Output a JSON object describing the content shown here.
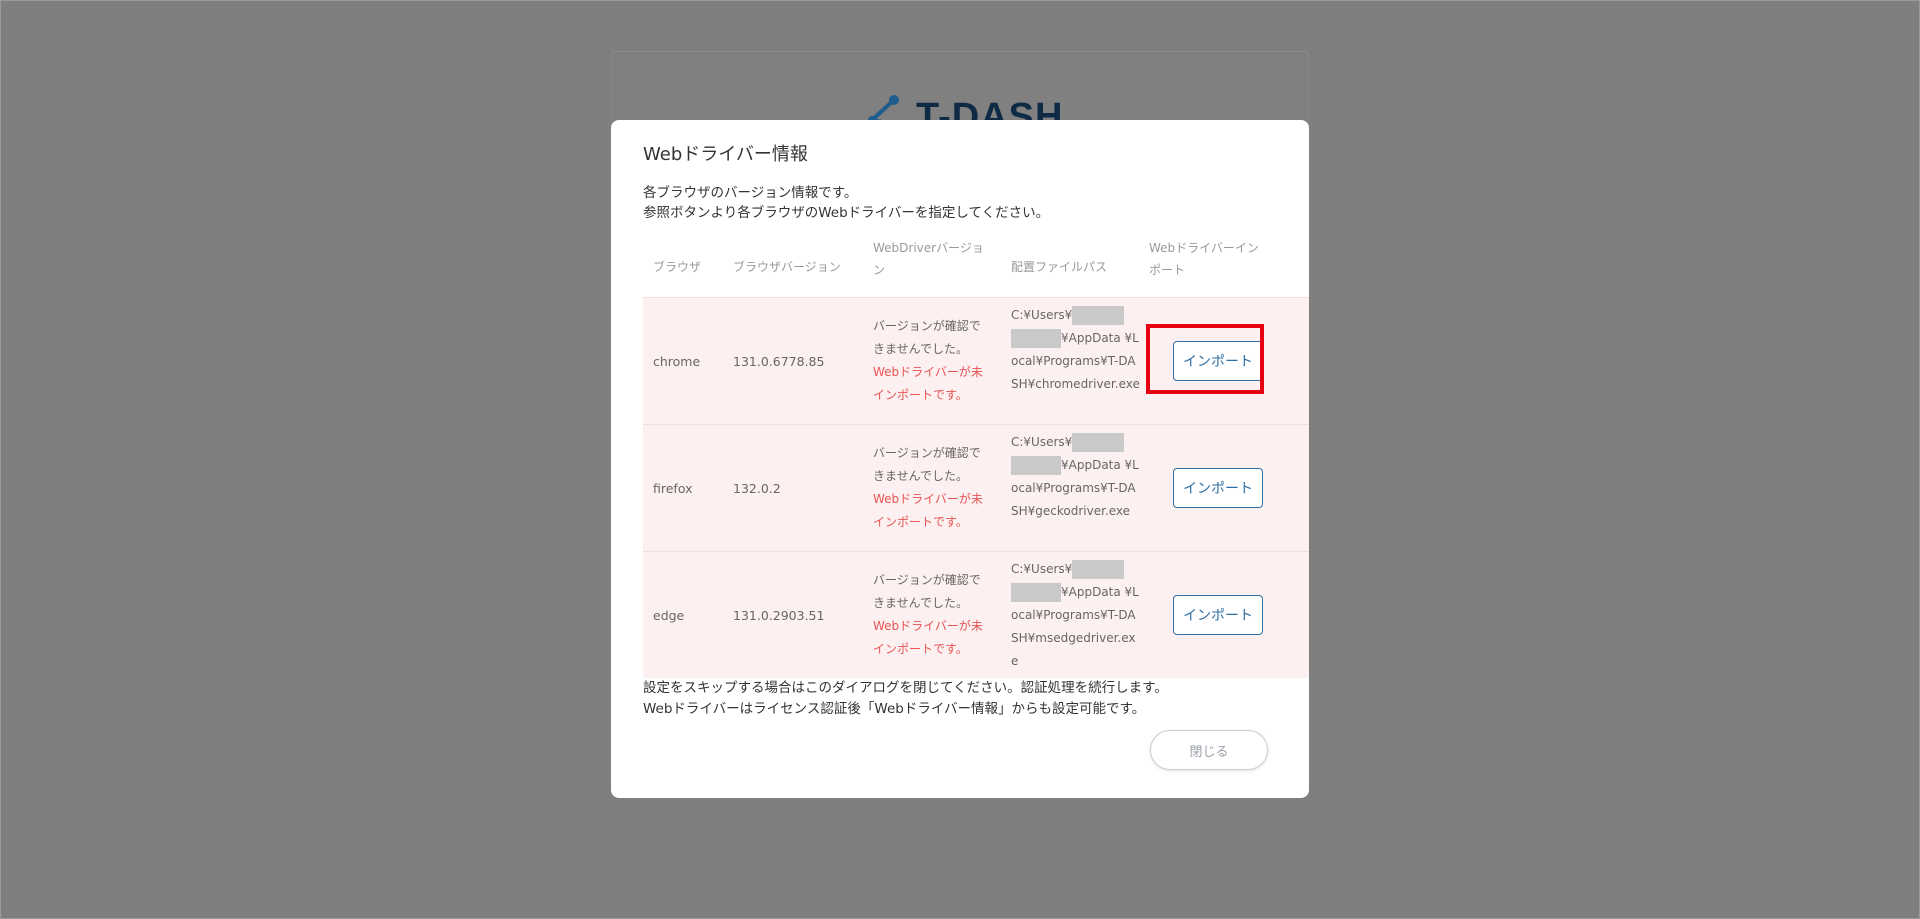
{
  "background": {
    "logo_text": "T-DASH"
  },
  "dialog": {
    "title": "Webドライバー情報",
    "description": [
      "各ブラウザのバージョン情報です。",
      "参照ボタンより各ブラウザのWebドライバーを指定してください。"
    ],
    "columns": {
      "browser": "ブラウザ",
      "browser_version": "ブラウザバージョン",
      "driver_version": [
        "WebDriverバージョ",
        "ン"
      ],
      "path": "配置ファイルパス",
      "import": [
        "Webドライバーイン",
        "ポート"
      ]
    },
    "rows": [
      {
        "browser": "chrome",
        "version": "131.0.6778.85",
        "status_lines": [
          "バージョンが確認で",
          "きませんでした。"
        ],
        "warning_lines": [
          "Webドライバーが未",
          "インポートです。"
        ],
        "path_start": "C:¥Users¥",
        "path_end": "¥AppData ¥Local¥Programs¥T-DASH¥chromedriver.exe",
        "import_label": "インポート"
      },
      {
        "browser": "firefox",
        "version": "132.0.2",
        "status_lines": [
          "バージョンが確認で",
          "きませんでした。"
        ],
        "warning_lines": [
          "Webドライバーが未",
          "インポートです。"
        ],
        "path_start": "C:¥Users¥",
        "path_end": "¥AppData ¥Local¥Programs¥T-DASH¥geckodriver.exe",
        "import_label": "インポート"
      },
      {
        "browser": "edge",
        "version": "131.0.2903.51",
        "status_lines": [
          "バージョンが確認で",
          "きませんでした。"
        ],
        "warning_lines": [
          "Webドライバーが未",
          "インポートです。"
        ],
        "path_start": "C:¥Users¥",
        "path_end": "¥AppData ¥Local¥Programs¥T-DASH¥msedgedriver.exe",
        "import_label": "インポート"
      }
    ],
    "notes": [
      "設定をスキップする場合はこのダイアログを閉じてください。認証処理を続行します。",
      "Webドライバーはライセンス認証後「Webドライバー情報」からも設定可能です。"
    ],
    "close_label": "閉じる"
  },
  "colors": {
    "overlay": "#7f7f7f",
    "row_background": "#fdf0f0",
    "warning_text": "#e85454",
    "button_accent": "#2d6ea4",
    "highlight_box": "#e60012"
  }
}
